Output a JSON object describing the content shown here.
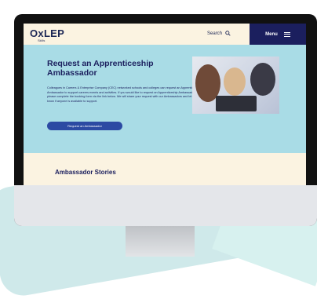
{
  "header": {
    "logo_main": "OxLEP",
    "logo_sub": "Skills",
    "search_label": "Search",
    "menu_label": "Menu"
  },
  "hero": {
    "title": "Request an Apprenticeship Ambassador",
    "description": "Colleagues in Careers & Enterprise Company (CEC) networked schools and colleges can request an Apprenticeship Ambassador to support careers events and activities. If you would like to request an Apprenticeship Ambassador, please complete the booking form via the link below. We will share your request with our Ambassadors and let you know if anyone is available to support.",
    "cta_label": "Request an Ambassador"
  },
  "stories": {
    "title": "Ambassador Stories"
  },
  "colors": {
    "header_bg": "#fbf3e1",
    "menu_bg": "#1b1f5e",
    "hero_bg": "#a9dce6",
    "cta_bg": "#2c4aa3",
    "text_navy": "#1b1f5e"
  },
  "icons": {
    "search": "search-icon",
    "menu": "hamburger-icon"
  }
}
